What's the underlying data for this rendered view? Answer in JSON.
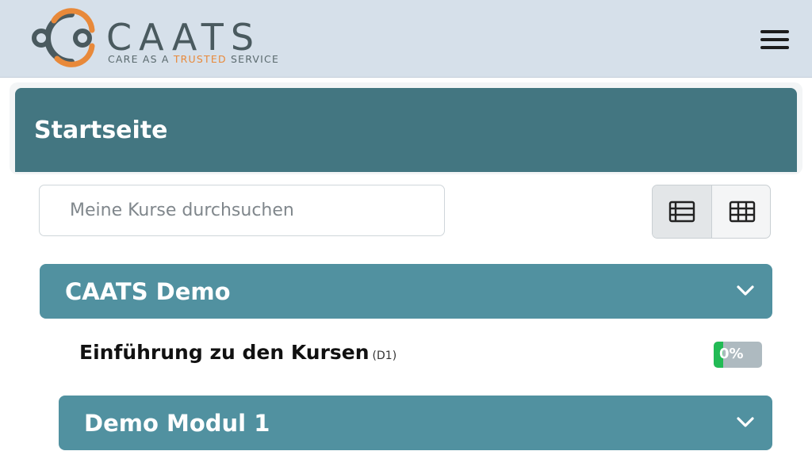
{
  "brand": {
    "name": "CAATS",
    "tagline_pre": "CARE AS A ",
    "tagline_highlight": "TRUSTED",
    "tagline_post": " SERVICE",
    "accent_color": "#e8893a",
    "ring_color": "#4a5a5f"
  },
  "header": {
    "menu_icon": "hamburger-icon"
  },
  "page": {
    "title": "Startseite"
  },
  "search": {
    "placeholder": "Meine Kurse durchsuchen",
    "value": ""
  },
  "view_toggle": {
    "options": [
      "list-view-icon",
      "grid-view-icon"
    ],
    "selected": "list-view-icon"
  },
  "groups": [
    {
      "title": "CAATS Demo",
      "expanded": true
    },
    {
      "title": "Demo Modul 1",
      "expanded": false
    }
  ],
  "courses": [
    {
      "title": "Einführung zu den Kursen",
      "code": "(D1)",
      "progress_label": "0%",
      "progress": 0
    }
  ],
  "colors": {
    "header_bg": "#d6e0ea",
    "title_bar": "#437681",
    "group_bar": "#5191a0",
    "progress_fill": "#22bb55"
  }
}
